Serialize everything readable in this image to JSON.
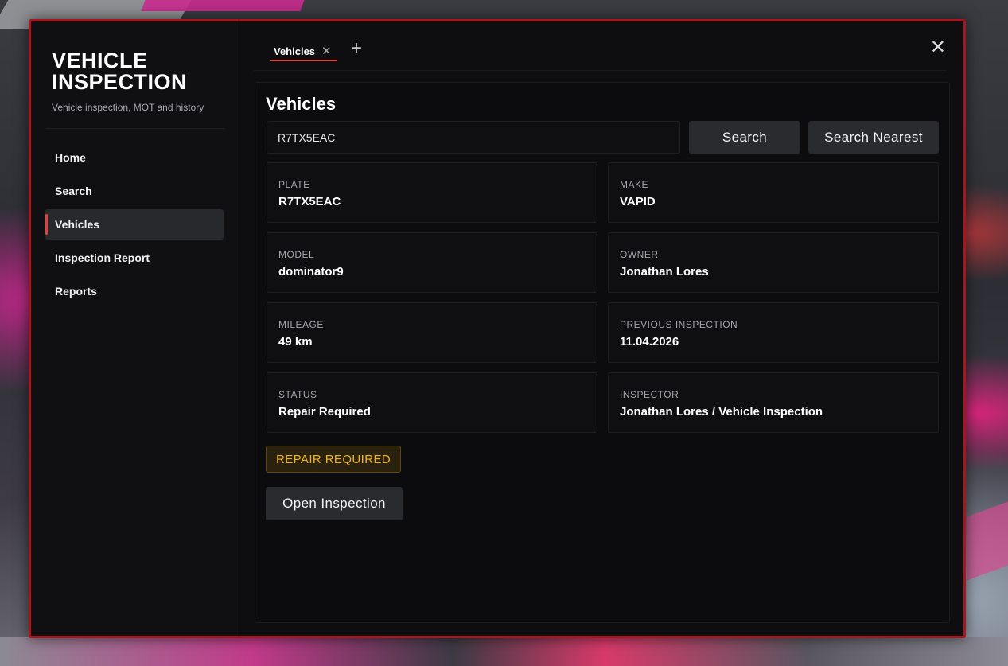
{
  "app": {
    "title": "VEHICLE INSPECTION",
    "subtitle": "Vehicle inspection, MOT and history"
  },
  "sidebar": {
    "items": [
      {
        "label": "Home",
        "active": false
      },
      {
        "label": "Search",
        "active": false
      },
      {
        "label": "Vehicles",
        "active": true
      },
      {
        "label": "Inspection Report",
        "active": false
      },
      {
        "label": "Reports",
        "active": false
      }
    ]
  },
  "tabs": {
    "items": [
      {
        "label": "Vehicles",
        "close_icon": "close-icon"
      }
    ],
    "add_icon": "plus-icon"
  },
  "window": {
    "close_icon": "close-icon"
  },
  "main": {
    "title": "Vehicles",
    "search": {
      "value": "R7TX5EAC",
      "placeholder": ""
    },
    "search_button": "Search",
    "search_nearest_button": "Search Nearest",
    "fields": {
      "plate": {
        "label": "PLATE",
        "value": "R7TX5EAC"
      },
      "make": {
        "label": "MAKE",
        "value": "VAPID"
      },
      "model": {
        "label": "MODEL",
        "value": "dominator9"
      },
      "owner": {
        "label": "OWNER",
        "value": "Jonathan Lores"
      },
      "mileage": {
        "label": "MILEAGE",
        "value": "49 km"
      },
      "previous_inspection": {
        "label": "PREVIOUS INSPECTION",
        "value": "11.04.2026"
      },
      "status": {
        "label": "STATUS",
        "value": "Repair Required"
      },
      "inspector": {
        "label": "INSPECTOR",
        "value": "Jonathan Lores / Vehicle Inspection"
      }
    },
    "status_badge": "REPAIR REQUIRED",
    "open_inspection_button": "Open Inspection"
  },
  "colors": {
    "accent": "#e0413b",
    "window_border": "#a5171d",
    "badge_text": "#efb423"
  }
}
